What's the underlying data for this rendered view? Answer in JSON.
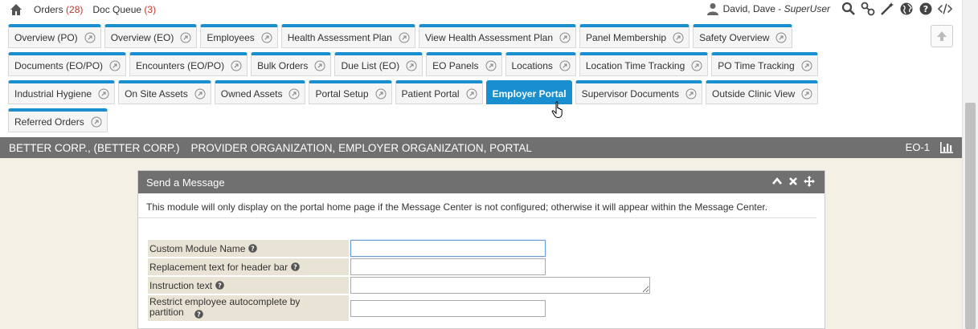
{
  "topbar": {
    "orders_label": "Orders",
    "orders_count": "(28)",
    "docqueue_label": "Doc Queue",
    "docqueue_count": "(3)",
    "user_name": "David, Dave - ",
    "user_role": "SuperUser"
  },
  "tabs": [
    [
      {
        "label": "Overview (PO)",
        "active": false
      },
      {
        "label": "Overview (EO)",
        "active": false
      },
      {
        "label": "Employees",
        "active": false
      },
      {
        "label": "Health Assessment Plan",
        "active": false
      },
      {
        "label": "View Health Assessment Plan",
        "active": false
      },
      {
        "label": "Panel Membership",
        "active": false
      },
      {
        "label": "Safety Overview",
        "active": false
      }
    ],
    [
      {
        "label": "Documents (EO/PO)",
        "active": false
      },
      {
        "label": "Encounters (EO/PO)",
        "active": false
      },
      {
        "label": "Bulk Orders",
        "active": false
      },
      {
        "label": "Due List (EO)",
        "active": false
      },
      {
        "label": "EO Panels",
        "active": false
      },
      {
        "label": "Locations",
        "active": false
      },
      {
        "label": "Location Time Tracking",
        "active": false
      },
      {
        "label": "PO Time Tracking",
        "active": false
      }
    ],
    [
      {
        "label": "Industrial Hygiene",
        "active": false
      },
      {
        "label": "On Site Assets",
        "active": false
      },
      {
        "label": "Owned Assets",
        "active": false
      },
      {
        "label": "Portal Setup",
        "active": false
      },
      {
        "label": "Patient Portal",
        "active": false
      },
      {
        "label": "Employer Portal",
        "active": true
      },
      {
        "label": "Supervisor Documents",
        "active": false
      },
      {
        "label": "Outside Clinic View",
        "active": false
      }
    ],
    [
      {
        "label": "Referred Orders",
        "active": false
      }
    ]
  ],
  "org": {
    "name": "BETTER CORP., (BETTER CORP.)",
    "types": "PROVIDER ORGANIZATION, EMPLOYER ORGANIZATION, PORTAL",
    "code": "EO-1"
  },
  "panel": {
    "title": "Send a Message",
    "note": "This module will only display on the portal home page if the Message Center is not configured; otherwise it will appear within the Message Center.",
    "fields": [
      {
        "label": "Custom Module Name",
        "type": "input",
        "value": "",
        "focus": true
      },
      {
        "label": "Replacement text for header bar",
        "type": "input",
        "value": "",
        "focus": false
      },
      {
        "label": "Instruction text",
        "type": "textarea",
        "value": "",
        "focus": false
      },
      {
        "label": "Restrict employee autocomplete by partition",
        "type": "input",
        "value": "",
        "focus": false
      }
    ]
  },
  "colors": {
    "tab_accent": "#1a8fd0",
    "header_gray": "#707070",
    "label_bg": "#e8e3d4",
    "content_bg": "#f5f0e6",
    "count_red": "#c0392b"
  }
}
